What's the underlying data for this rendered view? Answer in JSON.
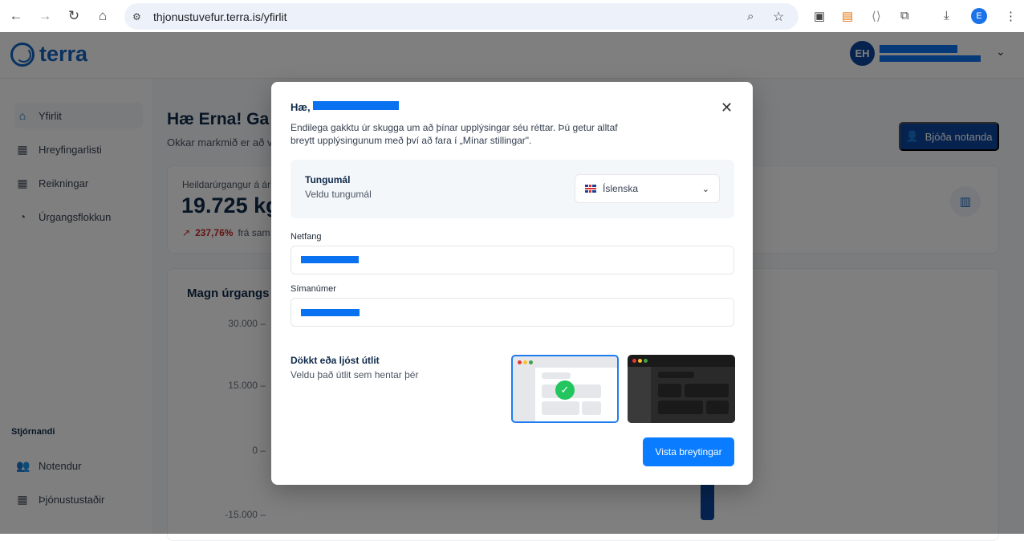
{
  "browser": {
    "url": "thjonustuvefur.terra.is/yfirlit",
    "profile_initial": "E"
  },
  "header": {
    "logo_text": "terra",
    "avatar_initials": "EH"
  },
  "sidebar": {
    "items": [
      {
        "label": "Yfirlit",
        "icon": "home-icon"
      },
      {
        "label": "Hreyfingarlisti",
        "icon": "building-icon"
      },
      {
        "label": "Reikningar",
        "icon": "building-icon"
      },
      {
        "label": "Úrgangsflokkun",
        "icon": "pie-chart-icon"
      }
    ],
    "admin_title": "Stjórnandi",
    "admin_items": [
      {
        "label": "Notendur",
        "icon": "users-icon"
      },
      {
        "label": "Þjónustustaðir",
        "icon": "building-icon"
      }
    ]
  },
  "main": {
    "greeting": "Hæ Erna! Ga",
    "subtitle": "Okkar markmið er að v",
    "invite_button": "Bjóða notanda",
    "stat": {
      "label": "Heildarúrgangur á árin",
      "value": "19.725 kg",
      "change": "237,76%",
      "change_suffix": "frá sam"
    },
    "chart": {
      "title": "Magn úrgangs",
      "y_ticks": [
        "30.000",
        "15.000",
        "0",
        "-15.000"
      ]
    }
  },
  "modal": {
    "title": "Hæ,",
    "description": "Endilega gakktu úr skugga um að þínar upplýsingar séu réttar. Þú getur alltaf breytt upplýsingunum með því að fara í „Mínar stillingar\".",
    "language": {
      "title": "Tungumál",
      "subtitle": "Veldu tungumál",
      "selected": "Íslenska"
    },
    "email_label": "Netfang",
    "phone_label": "Símanúmer",
    "theme": {
      "title": "Dökkt eða ljóst útlit",
      "subtitle": "Veldu það útlit sem hentar þér",
      "selected": "light"
    },
    "save_button": "Vista breytingar"
  },
  "colors": {
    "primary": "#0d47a1",
    "accent": "#0a7cff",
    "danger": "#c62828",
    "success": "#22c55e"
  }
}
